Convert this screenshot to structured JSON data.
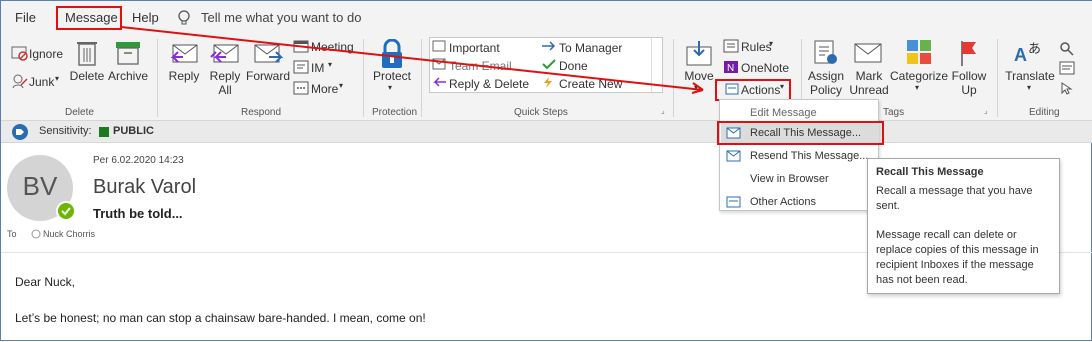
{
  "menu": {
    "file": "File",
    "message": "Message",
    "help": "Help",
    "tell_me": "Tell me what you want to do"
  },
  "ribbon": {
    "delete_group": {
      "ignore": "Ignore",
      "junk": "Junk",
      "delete": "Delete",
      "archive": "Archive",
      "label": "Delete"
    },
    "respond_group": {
      "reply": "Reply",
      "reply_all_1": "Reply",
      "reply_all_2": "All",
      "forward": "Forward",
      "meeting": "Meeting",
      "im": "IM",
      "more": "More",
      "label": "Respond"
    },
    "protection_group": {
      "protect_1": "Protect",
      "label": "Protection"
    },
    "quick_steps": {
      "items": [
        "Important",
        "To Manager",
        "Team Email",
        "Done",
        "Reply & Delete",
        "Create New"
      ],
      "label": "Quick Steps"
    },
    "move_group": {
      "move": "Move",
      "rules": "Rules",
      "onenote": "OneNote",
      "actions": "Actions"
    },
    "tags_group": {
      "assign_1": "Assign",
      "assign_2": "Policy",
      "mark_1": "Mark",
      "mark_2": "Unread",
      "categorize": "Categorize",
      "follow_1": "Follow",
      "follow_2": "Up",
      "label_partial": "Tags"
    },
    "editing_group": {
      "translate": "Translate",
      "label": "Editing"
    }
  },
  "sensitivity": {
    "label": "Sensitivity:",
    "value": "PUBLIC",
    "color": "#1e7a1e"
  },
  "header": {
    "initials": "BV",
    "date": "Per 6.02.2020 14:23",
    "sender": "Burak Varol",
    "subject": "Truth be told...",
    "to_label": "To",
    "recipient": "Nuck Chorris"
  },
  "body": {
    "greeting": "Dear Nuck,",
    "line1": "Let’s be honest; no man can stop a chainsaw bare-handed. I mean, come on!"
  },
  "actions_menu": {
    "items": [
      "Edit Message",
      "Recall This Message...",
      "Resend This Message...",
      "View in Browser",
      "Other Actions"
    ]
  },
  "tooltip": {
    "title": "Recall This Message",
    "line1": "Recall a message that you have sent.",
    "line2": "Message recall can delete or replace copies of this message in recipient Inboxes if the message has not been read."
  },
  "colors": {
    "accent": "#2b6cb0",
    "highlight_red": "#e01010",
    "avatar_bg": "#d4d4d4"
  }
}
